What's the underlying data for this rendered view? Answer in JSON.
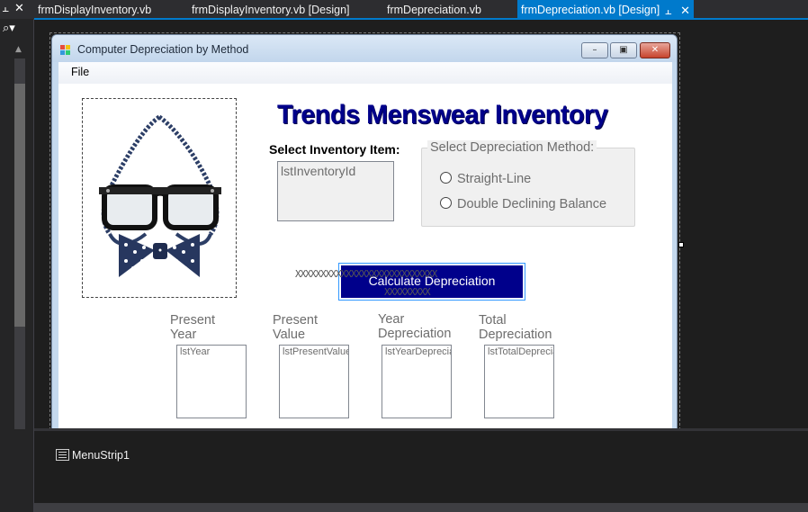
{
  "tabs": [
    {
      "label": "frmDisplayInventory.vb",
      "active": false
    },
    {
      "label": "frmDisplayInventory.vb [Design]",
      "active": false
    },
    {
      "label": "frmDepreciation.vb",
      "active": false
    },
    {
      "label": "frmDepreciation.vb [Design]",
      "active": true
    }
  ],
  "tab_icons": {
    "pin": "pin-icon",
    "close": "close-icon"
  },
  "panel_icons": {
    "pin": "pin-icon",
    "close": "close-icon",
    "search": "search-icon"
  },
  "form": {
    "title": "Computer Depreciation by Method",
    "menu_file": "File",
    "heading": "Trends Menswear Inventory",
    "select_item_label": "Select Inventory Item:",
    "inventory_list": "lstInventoryId",
    "group_label": "Select Depreciation Method:",
    "radio_straight": "Straight-Line",
    "radio_double": "Double Declining Balance",
    "calculate_button": "Calculate Depreciation",
    "placeholder_line1": "XXXXXXXXXXXXXXXXXXXXXXXXXXXX",
    "placeholder_line2": "XXXXXXXXX",
    "columns": [
      {
        "header": "Present Year",
        "list": "lstYear"
      },
      {
        "header": "Present Value",
        "list": "lstPresentValue"
      },
      {
        "header": "Year Depreciation",
        "list": "lstYearDepreciation"
      },
      {
        "header": "Total Depreciation",
        "list": "lstTotalDepreciation"
      }
    ]
  },
  "tray": {
    "menu_strip": "MenuStrip1"
  },
  "colors": {
    "accent": "#007acc",
    "heading": "#00008b",
    "button": "#00008b",
    "dark_bg": "#1e1e1e"
  }
}
